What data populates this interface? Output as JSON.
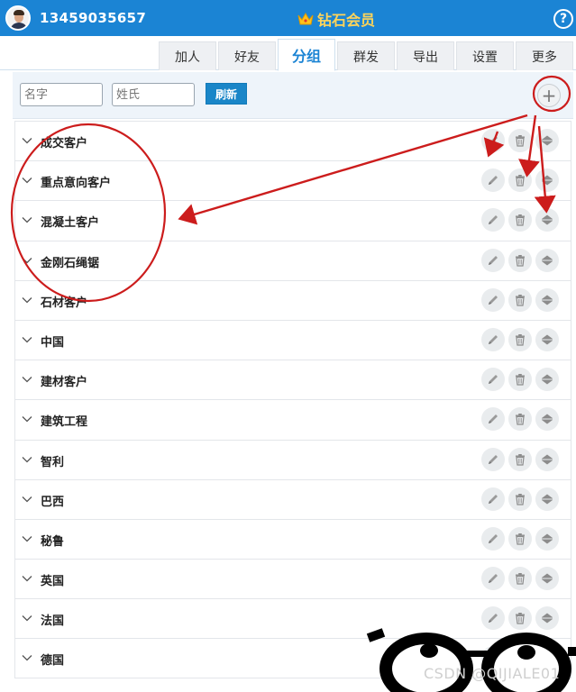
{
  "header": {
    "phone": "13459035657",
    "vip_label": "钻石会员",
    "help_glyph": "?",
    "bg_color": "#1b84d4",
    "vip_color": "#ffd45a"
  },
  "tabs": [
    {
      "label": "加人",
      "active": false
    },
    {
      "label": "好友",
      "active": false
    },
    {
      "label": "分组",
      "active": true
    },
    {
      "label": "群发",
      "active": false
    },
    {
      "label": "导出",
      "active": false
    },
    {
      "label": "设置",
      "active": false
    },
    {
      "label": "更多",
      "active": false
    }
  ],
  "toolbar": {
    "name_placeholder": "名字",
    "surname_placeholder": "姓氏",
    "refresh_label": "刷新",
    "add_glyph": "+"
  },
  "groups": [
    {
      "name": "成交客户"
    },
    {
      "name": "重点意向客户"
    },
    {
      "name": "混凝土客户"
    },
    {
      "name": "金刚石绳锯"
    },
    {
      "name": "石材客户"
    },
    {
      "name": "中国"
    },
    {
      "name": "建材客户"
    },
    {
      "name": "建筑工程"
    },
    {
      "name": "智利"
    },
    {
      "name": "巴西"
    },
    {
      "name": "秘鲁"
    },
    {
      "name": "英国"
    },
    {
      "name": "法国"
    },
    {
      "name": "德国"
    }
  ],
  "icons": {
    "row_buttons": [
      "pencil-icon",
      "trash-icon",
      "sort-arrows-icon"
    ],
    "expand": "chevron-down-icon"
  },
  "watermark": "CSDN @QIJIALE01",
  "annotation_color": "#cc1c1c"
}
